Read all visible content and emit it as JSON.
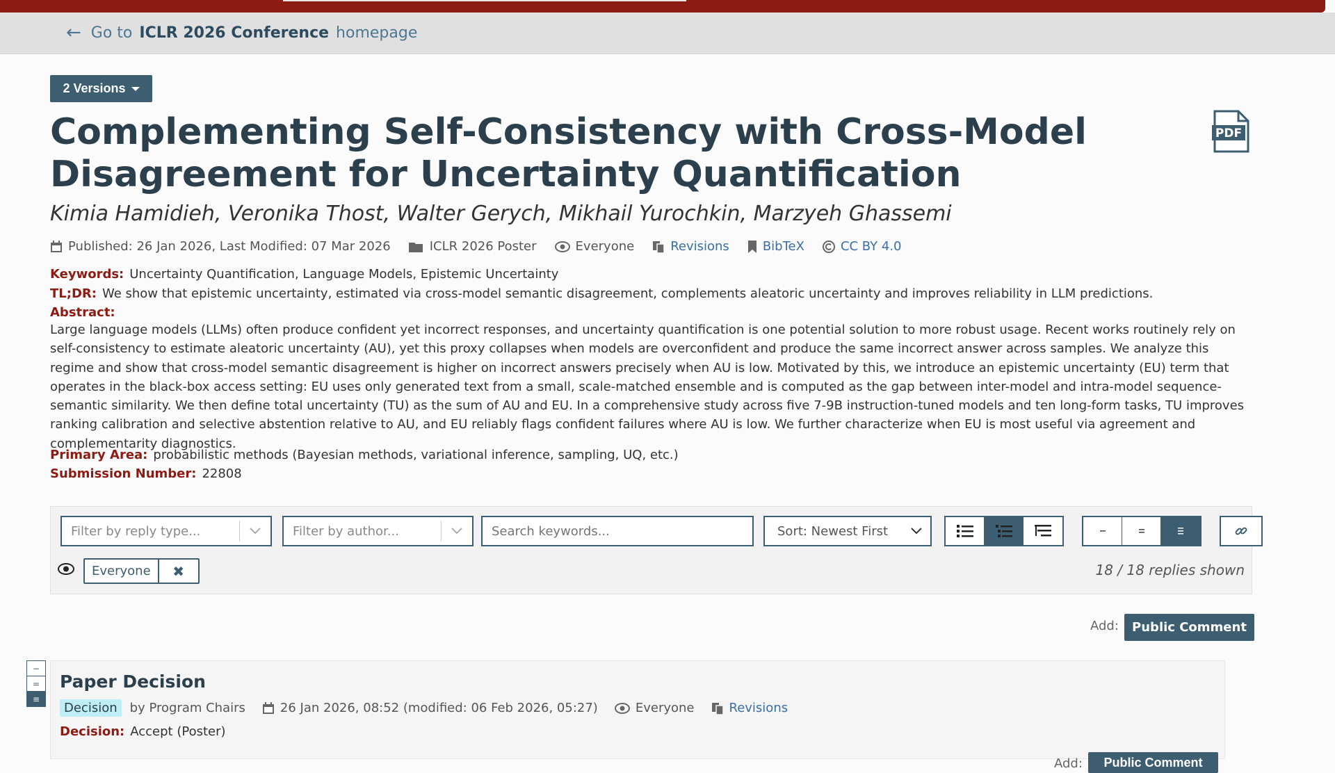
{
  "nav": {
    "back_prefix": "Go to",
    "back_venue": "ICLR 2026 Conference",
    "back_suffix": "homepage"
  },
  "versions_label": "2 Versions",
  "paper": {
    "title": "Complementing Self-Consistency with Cross-Model Disagreement for Uncertainty Quantification",
    "pdf_label": "PDF",
    "authors": "Kimia Hamidieh, Veronika Thost, Walter Gerych, Mikhail Yurochkin, Marzyeh Ghassemi",
    "published": "Published: 26 Jan 2026, Last Modified: 07 Mar 2026",
    "venue": "ICLR 2026 Poster",
    "readers": "Everyone",
    "revisions": "Revisions",
    "bibtex": "BibTeX",
    "license": "CC BY 4.0",
    "keywords_label": "Keywords:",
    "keywords": "Uncertainty Quantification, Language Models, Epistemic Uncertainty",
    "tldr_label": "TL;DR:",
    "tldr": "We show that epistemic uncertainty, estimated via cross-model semantic disagreement, complements aleatoric uncertainty and improves reliability in LLM predictions.",
    "abstract_label": "Abstract:",
    "abstract": "Large language models (LLMs) often produce confident yet incorrect responses, and uncertainty quantification is one potential solution to more robust usage. Recent works routinely rely on self-consistency to estimate aleatoric uncertainty (AU), yet this proxy collapses when models are overconfident and produce the same incorrect answer across samples. We analyze this regime and show that cross-model semantic disagreement is higher on incorrect answers precisely when AU is low. Motivated by this, we introduce an epistemic uncertainty (EU) term that operates in the black-box access setting: EU uses only generated text from a small, scale-matched ensemble and is computed as the gap between inter-model and intra-model sequence-semantic similarity. We then define total uncertainty (TU) as the sum of AU and EU. In a comprehensive study across five 7-9B instruction-tuned models and ten long-form tasks, TU improves ranking calibration and selective abstention relative to AU, and EU reliably flags confident failures where AU is low. We further characterize when EU is most useful via agreement and complementarity diagnostics.",
    "primary_area_label": "Primary Area:",
    "primary_area": "probabilistic methods (Bayesian methods, variational inference, sampling, UQ, etc.)",
    "submission_label": "Submission Number:",
    "submission_number": "22808"
  },
  "filters": {
    "reply_type_placeholder": "Filter by reply type...",
    "author_placeholder": "Filter by author...",
    "search_placeholder": "Search keywords...",
    "sort_label": "Sort: Newest First",
    "readers_chip": "Everyone",
    "replies_shown": "18 / 18 replies shown"
  },
  "add_label": "Add:",
  "public_comment_label": "Public Comment",
  "note": {
    "title": "Paper Decision",
    "badge": "Decision",
    "by": "by Program Chairs",
    "date": "26 Jan 2026, 08:52 (modified: 06 Feb 2026, 05:27)",
    "readers": "Everyone",
    "revisions": "Revisions",
    "decision_label": "Decision:",
    "decision_value": "Accept (Poster)",
    "add_label": "Add:",
    "public_comment_label": "Public Comment"
  },
  "colors": {
    "brand_red": "#8c1b13",
    "primary": "#3d5d71",
    "link": "#3a6ea5"
  }
}
